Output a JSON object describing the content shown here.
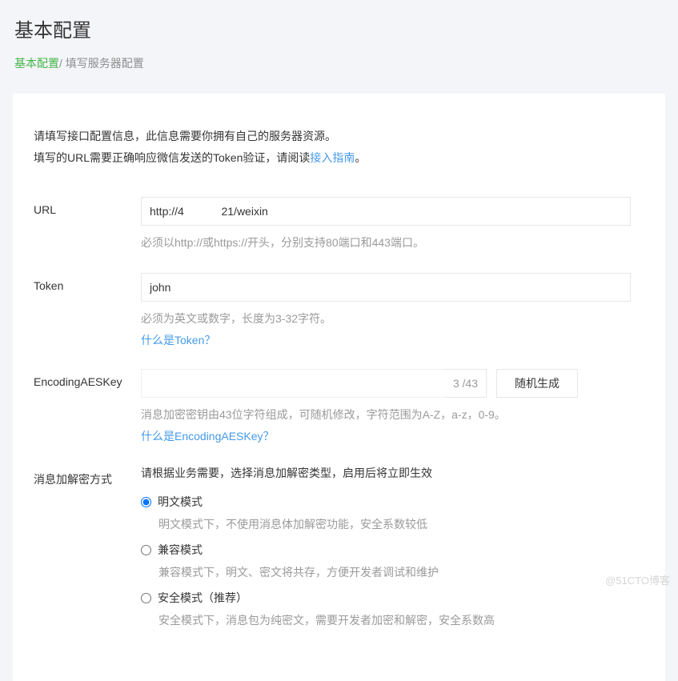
{
  "header": {
    "title": "基本配置",
    "breadcrumb_active": "基本配置",
    "breadcrumb_sep": "/ ",
    "breadcrumb_current": "填写服务器配置"
  },
  "intro": {
    "line1": "请填写接口配置信息，此信息需要你拥有自己的服务器资源。",
    "line2_pre": "填写的URL需要正确响应微信发送的Token验证，请阅读",
    "line2_link": "接入指南",
    "line2_post": "。"
  },
  "form": {
    "url": {
      "label": "URL",
      "value": "http://4            21/weixin",
      "hint": "必须以http://或https://开头，分别支持80端口和443端口。"
    },
    "token": {
      "label": "Token",
      "value": "john",
      "hint": "必须为英文或数字，长度为3-32字符。",
      "help_link": "什么是Token？"
    },
    "aes": {
      "label": "EncodingAESKey",
      "value": "                                         ",
      "count": "3 /43",
      "button": "随机生成",
      "hint": "消息加密密钥由43位字符组成，可随机修改，字符范围为A-Z，a-z，0-9。",
      "help_link": "什么是EncodingAESKey？"
    },
    "mode": {
      "label": "消息加解密方式",
      "desc": "请根据业务需要，选择消息加解密类型，启用后将立即生效",
      "options": [
        {
          "label": "明文模式",
          "hint": "明文模式下，不使用消息体加解密功能，安全系数较低",
          "checked": true
        },
        {
          "label": "兼容模式",
          "hint": "兼容模式下，明文、密文将共存，方便开发者调试和维护",
          "checked": false
        },
        {
          "label": "安全模式（推荐）",
          "hint": "安全模式下，消息包为纯密文，需要开发者加密和解密，安全系数高",
          "checked": false
        }
      ]
    }
  },
  "watermark": "@51CTO博客"
}
